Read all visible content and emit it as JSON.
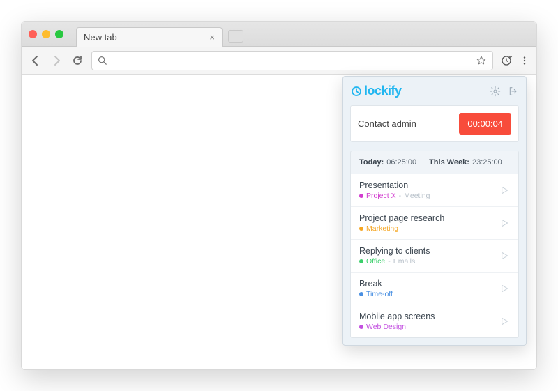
{
  "browser": {
    "tab_title": "New tab"
  },
  "popup": {
    "brand": "lockify",
    "current": {
      "description": "Contact admin",
      "timer": "00:00:04"
    },
    "summary": {
      "today_label": "Today:",
      "today_value": "06:25:00",
      "week_label": "This Week:",
      "week_value": "23:25:00"
    },
    "entries": [
      {
        "title": "Presentation",
        "project": "Project X",
        "project_color": "#d23ccf",
        "task": "Meeting"
      },
      {
        "title": "Project page research",
        "project": "Marketing",
        "project_color": "#f5a623",
        "task": ""
      },
      {
        "title": "Replying to clients",
        "project": "Office",
        "project_color": "#3bcf6a",
        "task": "Emails"
      },
      {
        "title": "Break",
        "project": "Time-off",
        "project_color": "#4a90e2",
        "task": ""
      },
      {
        "title": "Mobile app screens",
        "project": "Web Design",
        "project_color": "#c350e0",
        "task": ""
      }
    ]
  }
}
